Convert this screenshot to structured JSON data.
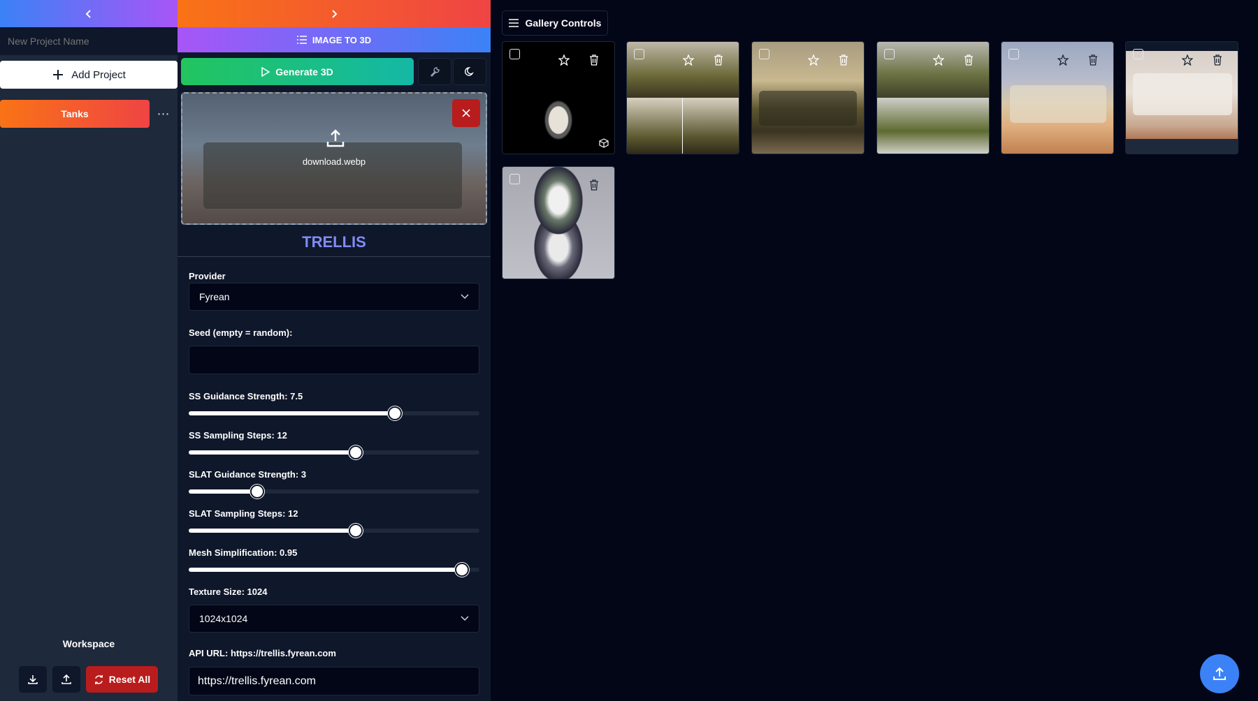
{
  "sidebar": {
    "collapse_icon": "chevron-left-icon",
    "project_name_placeholder": "New Project Name",
    "add_project_label": "Add Project",
    "projects": [
      {
        "label": "Tanks"
      }
    ],
    "more_label": "⋯",
    "workspace_label": "Workspace",
    "reset_label": "Reset All"
  },
  "panel": {
    "expand_icon": "chevron-right-icon",
    "tab_label": "IMAGE TO 3D",
    "generate_label": "Generate 3D",
    "uploaded_file": "download.webp",
    "model_title": "TRELLIS",
    "provider_label": "Provider",
    "provider_value": "Fyrean",
    "seed_label": "Seed (empty = random):",
    "seed_value": "",
    "ss_guidance_label": "SS Guidance Strength: 7.5",
    "ss_guidance_fraction": 0.71,
    "ss_steps_label": "SS Sampling Steps: 12",
    "ss_steps_fraction": 0.575,
    "slat_guidance_label": "SLAT Guidance Strength: 3",
    "slat_guidance_fraction": 0.235,
    "slat_steps_label": "SLAT Sampling Steps: 12",
    "slat_steps_fraction": 0.575,
    "mesh_simpl_label": "Mesh Simplification: 0.95",
    "mesh_simpl_fraction": 0.94,
    "texture_label": "Texture Size: 1024",
    "texture_value": "1024x1024",
    "api_label": "API URL: https://trellis.fyrean.com",
    "api_value": "https://trellis.fyrean.com"
  },
  "gallery": {
    "controls_label": "Gallery Controls",
    "item_count": 7
  },
  "colors": {
    "accent_blue": "#3b82f6",
    "accent_purple": "#a855f7",
    "accent_orange": "#f97316",
    "danger_red": "#b91c1c",
    "generate_green": "#22c55e",
    "title_indigo": "#818cf8"
  }
}
